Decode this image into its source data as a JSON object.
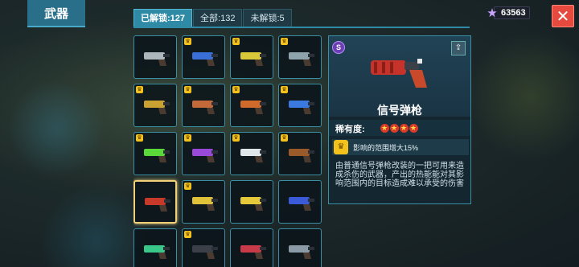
{
  "header": {
    "title": "武器"
  },
  "currency": {
    "icon": "star-gem-icon",
    "amount": "63563"
  },
  "close": {
    "icon": "close-icon",
    "label": "✕"
  },
  "tabs": [
    {
      "label": "已解锁:127",
      "active": true
    },
    {
      "label": "全部:132",
      "active": false
    },
    {
      "label": "未解锁:5",
      "active": false
    }
  ],
  "weapons": [
    {
      "name": "silver-pistol",
      "crown": false,
      "color": "#aeb6bd"
    },
    {
      "name": "blue-blaster",
      "crown": true,
      "color": "#3a6fd8"
    },
    {
      "name": "yellow-ray-gun",
      "crown": true,
      "color": "#d9c93a"
    },
    {
      "name": "silver-revolver",
      "crown": true,
      "color": "#8fa3ad"
    },
    {
      "name": "gold-smg",
      "crown": true,
      "color": "#c9a232"
    },
    {
      "name": "copper-cannon",
      "crown": true,
      "color": "#c46a3a"
    },
    {
      "name": "orange-blaster",
      "crown": true,
      "color": "#d06a2a"
    },
    {
      "name": "blue-laser-rifle",
      "crown": true,
      "color": "#3a7ae0"
    },
    {
      "name": "green-plasma",
      "crown": true,
      "color": "#5ad83a"
    },
    {
      "name": "purple-ray",
      "crown": true,
      "color": "#9a4ad8"
    },
    {
      "name": "white-blade",
      "crown": true,
      "color": "#dfe6ea"
    },
    {
      "name": "brown-shotgun",
      "crown": true,
      "color": "#9a5a2a"
    },
    {
      "name": "red-flare-gun",
      "crown": false,
      "color": "#c73a2a"
    },
    {
      "name": "yellow-blaster",
      "crown": true,
      "color": "#e0c23a"
    },
    {
      "name": "yellow-sonic",
      "crown": false,
      "color": "#e6c93a"
    },
    {
      "name": "blue-sniper",
      "crown": false,
      "color": "#3a5ad8"
    },
    {
      "name": "green-orb",
      "crown": false,
      "color": "#3ac88a"
    },
    {
      "name": "dark-rifle",
      "crown": true,
      "color": "#3a3f48"
    },
    {
      "name": "red-launcher",
      "crown": false,
      "color": "#c73a4a"
    },
    {
      "name": "grey-drone",
      "crown": false,
      "color": "#8a9aa6"
    }
  ],
  "selected_index": 12,
  "detail": {
    "badge": "S",
    "share_icon": "share-icon",
    "name": "信号弹枪",
    "rarity_label": "稀有度:",
    "stars": 4,
    "effect_text": "影响的范围增大15%",
    "description": "由普通信号弹枪改装的一把可用来造成杀伤的武器，产出的热能能对其影响范围内的目标造成难以承受的伤害"
  },
  "colors": {
    "accent": "#2f8aa6",
    "close": "#e64a3e",
    "gold": "#f4c21b"
  }
}
